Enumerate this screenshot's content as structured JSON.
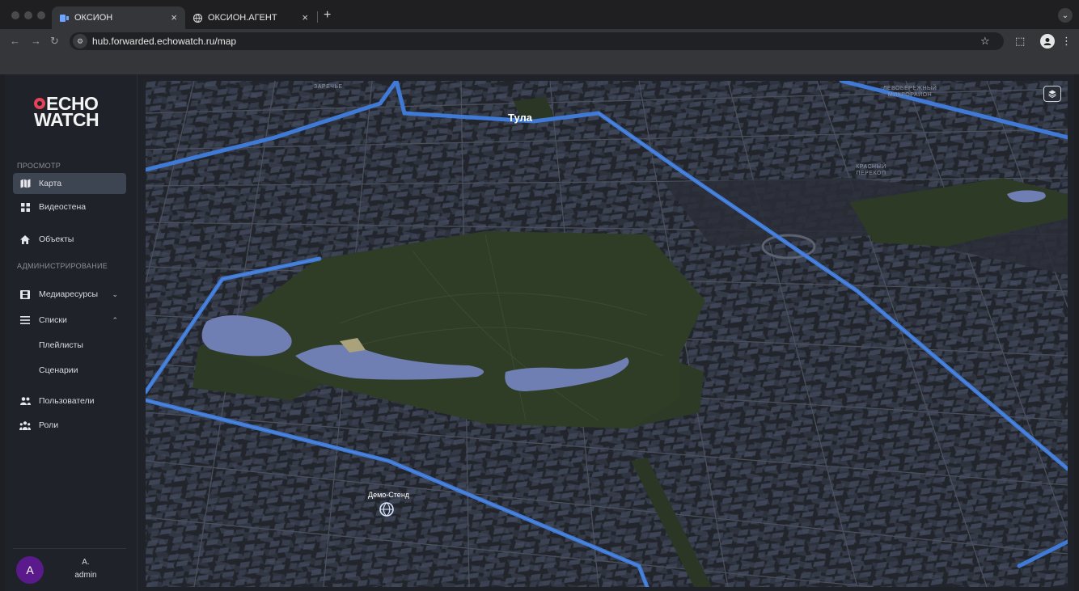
{
  "browser": {
    "tabs": [
      {
        "title": "ОКСИОН",
        "active": true
      },
      {
        "title": "ОКСИОН.АГЕНТ",
        "active": false
      }
    ],
    "url": "hub.forwarded.echowatch.ru/map"
  },
  "brand": {
    "line1": "ECHO",
    "line2": "WATCH",
    "accent": "#e8425a"
  },
  "sidebar": {
    "section_view": "ПРОСМОТР",
    "section_admin": "АДМИНИСТРИРОВАНИЕ",
    "items": {
      "map": {
        "label": "Карта",
        "icon": "map-icon",
        "active": true
      },
      "videowall": {
        "label": "Видеостена",
        "icon": "grid-icon"
      },
      "objects": {
        "label": "Объекты",
        "icon": "home-icon"
      },
      "media": {
        "label": "Медиаресурсы",
        "icon": "film-icon",
        "expanded": false
      },
      "lists": {
        "label": "Списки",
        "icon": "list-icon",
        "expanded": true
      },
      "playlists": {
        "label": "Плейлисты"
      },
      "scenarios": {
        "label": "Сценарии"
      },
      "users": {
        "label": "Пользователи",
        "icon": "users-icon"
      },
      "roles": {
        "label": "Роли",
        "icon": "roles-icon"
      }
    },
    "user": {
      "initial": "A",
      "name": "A.",
      "role": "admin",
      "avatar_color": "#5a1a8c"
    }
  },
  "map": {
    "city_label": "Тула",
    "district_top": "ЗАРЕЧЬЕ",
    "district_topright": "ЛЕВОБЕРЕЖНЫЙ МИКРОРАЙОН",
    "district_right": "КРАСНЫЙ ПЕРЕКОП",
    "marker_label": "Демо-Стенд",
    "park_color": "#2e3b26",
    "water_color": "#6f7fb4",
    "road_color": "#3f7ad6"
  }
}
